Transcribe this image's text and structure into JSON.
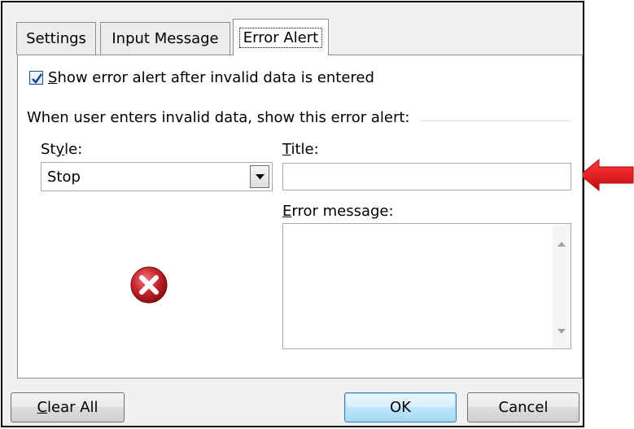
{
  "tabs": [
    {
      "label": "Settings",
      "active": false
    },
    {
      "label": "Input Message",
      "active": false
    },
    {
      "label": "Error Alert",
      "active": true
    }
  ],
  "checkbox": {
    "checked": true,
    "label_mnemonic": "S",
    "label_rest": "how error alert after invalid data is entered"
  },
  "section_label": "When user enters invalid data, show this error alert:",
  "style_field": {
    "label_pre": "St",
    "label_mnemonic": "y",
    "label_post": "le:",
    "selected_value": "Stop"
  },
  "title_field": {
    "label_mnemonic": "T",
    "label_rest": "itle:",
    "value": ""
  },
  "error_message_field": {
    "label_mnemonic": "E",
    "label_rest": "rror message:",
    "value": ""
  },
  "buttons": {
    "clear_all_mnemonic": "C",
    "clear_all_rest": "lear All",
    "ok": "OK",
    "cancel": "Cancel"
  },
  "icons": {
    "style_icon": "stop-error-icon",
    "annotation": "red-arrow-icon"
  },
  "colors": {
    "stop_icon": "#c0282d",
    "annotation_arrow": "#e8141c",
    "default_button_border": "#3c7fb1"
  }
}
